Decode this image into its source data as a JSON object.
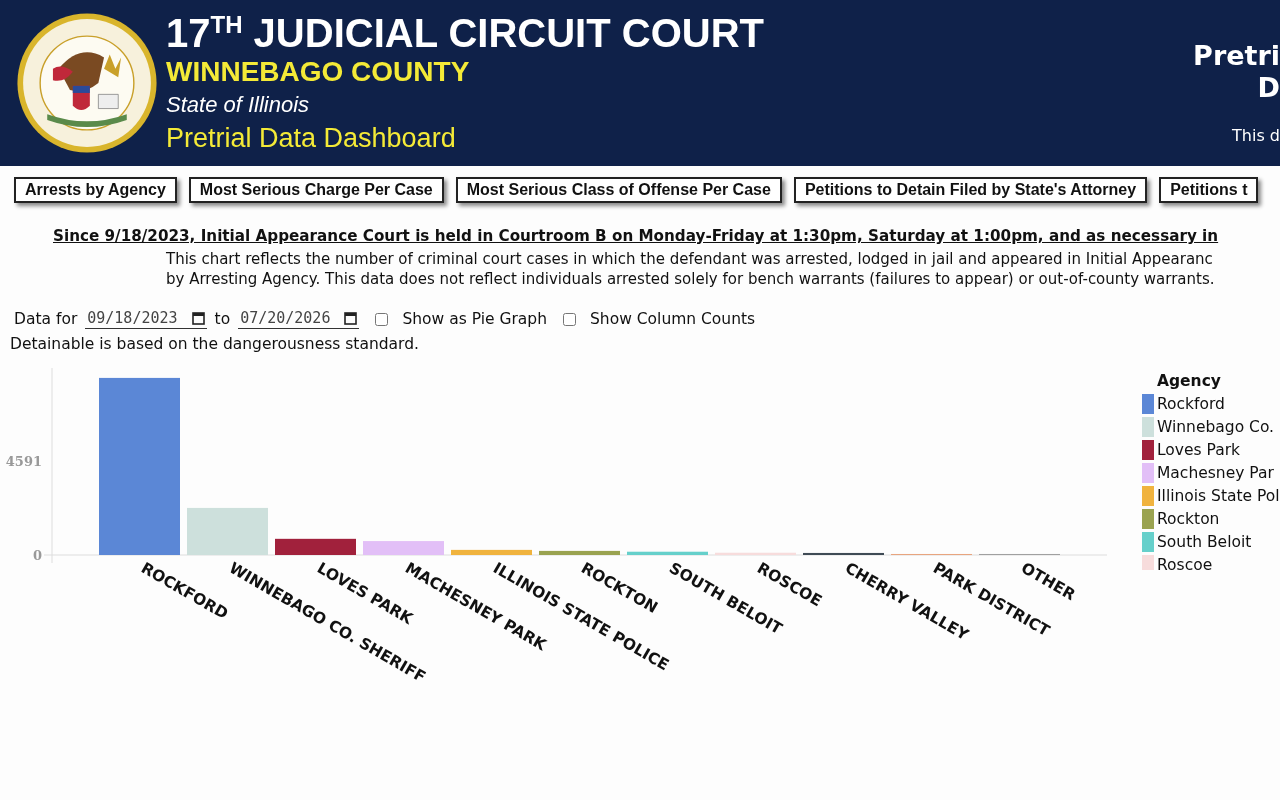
{
  "header": {
    "title": "17$^{TH}$ JUDICIAL CIRCUIT COURT",
    "county": "WINNEBAGO COUNTY",
    "state": "State of Illinois",
    "subtitle": "Pretrial Data Dashboard",
    "right_title_1": "Pretri",
    "right_title_2": "D",
    "right_note": "This d"
  },
  "tabs": [
    {
      "label": "Arrests by Agency"
    },
    {
      "label": "Most Serious Charge Per Case"
    },
    {
      "label": "Most Serious Class of Offense Per Case"
    },
    {
      "label": "Petitions to Detain Filed by State's Attorney"
    },
    {
      "label": "Petitions t"
    }
  ],
  "notice": "Since 9/18/2023, Initial Appearance Court is held in Courtroom B on Monday-Friday at 1:30pm, Saturday at 1:00pm, and as necessary in",
  "description": [
    "This chart reflects the number of criminal court cases in which the defendant was arrested, lodged in jail and appeared in Initial Appearanc",
    "by Arresting Agency. This data does not reflect individuals arrested solely for bench warrants (failures to appear) or out-of-county warrants."
  ],
  "filters": {
    "label": "Data for",
    "from": "09/18/2023",
    "to_label": "to",
    "to": "07/20/2026",
    "options": [
      {
        "label": "Show as Pie Graph",
        "checked": false
      },
      {
        "label": "Show Column Counts",
        "checked": false
      }
    ]
  },
  "standard_note": "Detainable is based on the dangerousness standard.",
  "chart": {
    "chart_data": {
      "type": "bar",
      "categories": [
        "ROCKFORD",
        "WINNEBAGO CO. SHERIFF",
        "LOVES PARK",
        "MACHESNEY PARK",
        "ILLINOIS STATE POLICE",
        "ROCKTON",
        "SOUTH BELOIT",
        "ROSCOE",
        "CHERRY VALLEY",
        "PARK DISTRICT",
        "OTHER"
      ],
      "values": [
        8650,
        2300,
        790,
        680,
        250,
        200,
        160,
        110,
        100,
        50,
        50
      ],
      "ylim": [
        0,
        9134
      ],
      "yticks": [
        0,
        4591
      ]
    },
    "bars": [
      {
        "color": "#5b87d6"
      },
      {
        "color": "#cde0dc"
      },
      {
        "color": "#a1213c"
      },
      {
        "color": "#e2bff7"
      },
      {
        "color": "#f0b33e"
      },
      {
        "color": "#9aa350"
      },
      {
        "color": "#66d0cb"
      },
      {
        "color": "#f7dcdc"
      },
      {
        "color": "#3f4b55"
      },
      {
        "color": "#e8a57f"
      },
      {
        "color": "#a0a0a0"
      }
    ],
    "legend": {
      "title": "Agency",
      "items": [
        {
          "label": "Rockford",
          "color": "#5b87d6"
        },
        {
          "label": "Winnebago Co.",
          "color": "#cde0dc"
        },
        {
          "label": "Loves Park",
          "color": "#a1213c"
        },
        {
          "label": "Machesney Par",
          "color": "#e2bff7"
        },
        {
          "label": "Illinois State Pol",
          "color": "#f0b33e"
        },
        {
          "label": "Rockton",
          "color": "#9aa350"
        },
        {
          "label": "South Beloit",
          "color": "#66d0cb"
        },
        {
          "label": "Roscoe",
          "color": "#f7dcdc"
        }
      ]
    }
  }
}
